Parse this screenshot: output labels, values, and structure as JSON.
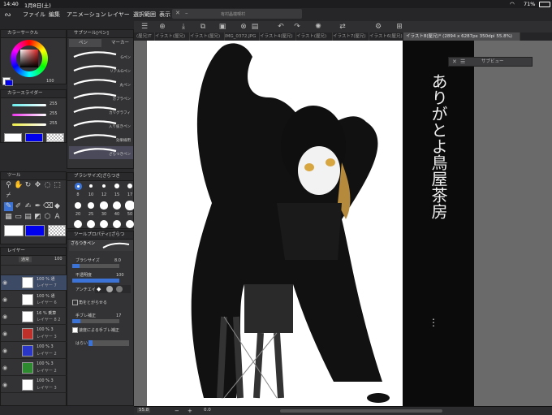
{
  "status": {
    "time": "14:40",
    "date": "1月8日(土)",
    "battery": "71%"
  },
  "menu": {
    "items": [
      "ファイル",
      "編集",
      "アニメーション",
      "レイヤー",
      "選択範囲",
      "表示"
    ]
  },
  "title_window": "有村晶端喫村",
  "tabs": [
    {
      "label": "(屋兄)T"
    },
    {
      "label": "イラスト(屋兄)"
    },
    {
      "label": "イラスト(屋兄)"
    },
    {
      "label": "IMG_0372.JPG"
    },
    {
      "label": "イラスト4(屋兄)"
    },
    {
      "label": "イラスト(屋兄)"
    },
    {
      "label": "イラスト7(屋兄)"
    },
    {
      "label": "イラスト6(屋兄)"
    },
    {
      "label": "イラスト8(屋兄)* (2894 x 6287px 350dpi 55.8%)"
    }
  ],
  "panels": {
    "color_circle_title": "カラーサークル",
    "color_value": "100",
    "sub_tool_title": "サブツール[ペン]",
    "pen_tab": "ペン",
    "marker_tab": "マーカー",
    "brushes": [
      "Gペン",
      "リアルGペン",
      "丸ペン",
      "カブラペン",
      "カリグラフィ",
      "入り抜きペン",
      "効果線用",
      "ざらつきペン"
    ],
    "color_slider_title": "カラースライダー",
    "slider_values": [
      "255",
      "255",
      "255"
    ],
    "tool_title": "ツール",
    "brush_size_title": "ブラシサイズ[ざらつき",
    "brush_sizes": [
      "8",
      "10",
      "12",
      "15",
      "17",
      "20",
      "25",
      "30",
      "40",
      "50"
    ],
    "tool_property_title": "ツールプロパティ[ざらつ",
    "tool_property_label": "ざらつきペン",
    "prop_brush_size": "ブラシサイズ",
    "prop_brush_size_val": "8.0",
    "prop_opacity": "不透明度",
    "prop_opacity_val": "100",
    "prop_antialias": "アンチエイリ",
    "prop_corner": "角をとがらせる",
    "prop_stabilization": "手ブレ補正",
    "prop_stabilization_val": "17",
    "prop_speed": "速度による手ブレ補正",
    "prop_speed_val": "100",
    "prop_hanare": "はらい",
    "layer_title": "レイヤー",
    "layer_blend": "通常",
    "layer_opacity": "100"
  },
  "layers": [
    {
      "pct": "100 % 通",
      "name": "レイヤー 7",
      "thumb": "#ffffff"
    },
    {
      "pct": "100 % 通",
      "name": "レイヤー 6",
      "thumb": "#ffffff"
    },
    {
      "pct": "16 % 乗算",
      "name": "レイヤー 8 2",
      "thumb": "#ffffff"
    },
    {
      "pct": "100 % 3",
      "name": "レイヤー 3",
      "thumb": "#c0302a"
    },
    {
      "pct": "100 % 3",
      "name": "レイヤー 2",
      "thumb": "#2a36c8"
    },
    {
      "pct": "100 % 3",
      "name": "レイヤー 2",
      "thumb": "#2e8a2e"
    },
    {
      "pct": "100 % 3",
      "name": "レイヤー 3",
      "thumb": "#ffffff"
    }
  ],
  "subview_title": "サブビュー",
  "canvas_text": "ありがとよ鳥屋茶房",
  "zoom": "55.8",
  "bottom_value": "0.0",
  "colors": {
    "main_color": "#ffffff",
    "sub_color": "#0000ee",
    "accent": "#3b74d6"
  }
}
